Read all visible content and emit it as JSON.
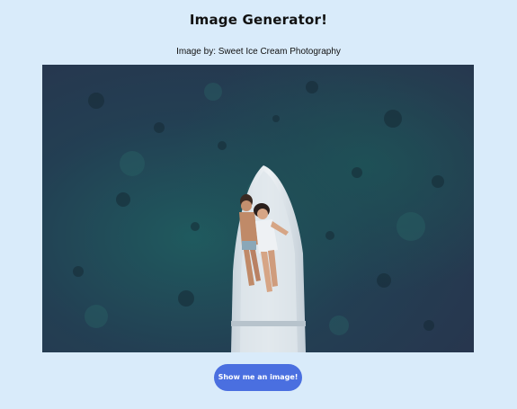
{
  "header": {
    "title": "Image Generator!"
  },
  "photo": {
    "credit": "Image by: Sweet Ice Cream Photography",
    "subject": "aerial view of a couple lying on a white boat over dark teal water"
  },
  "actions": {
    "generate_label": "Show me an image!"
  },
  "colors": {
    "page_background": "#d9ebfa",
    "button_background": "#4a6fe0",
    "button_text": "#ffffff",
    "water_dark": "#22364a",
    "water_teal": "#1f5a5e",
    "boat": "#e9eef2"
  }
}
